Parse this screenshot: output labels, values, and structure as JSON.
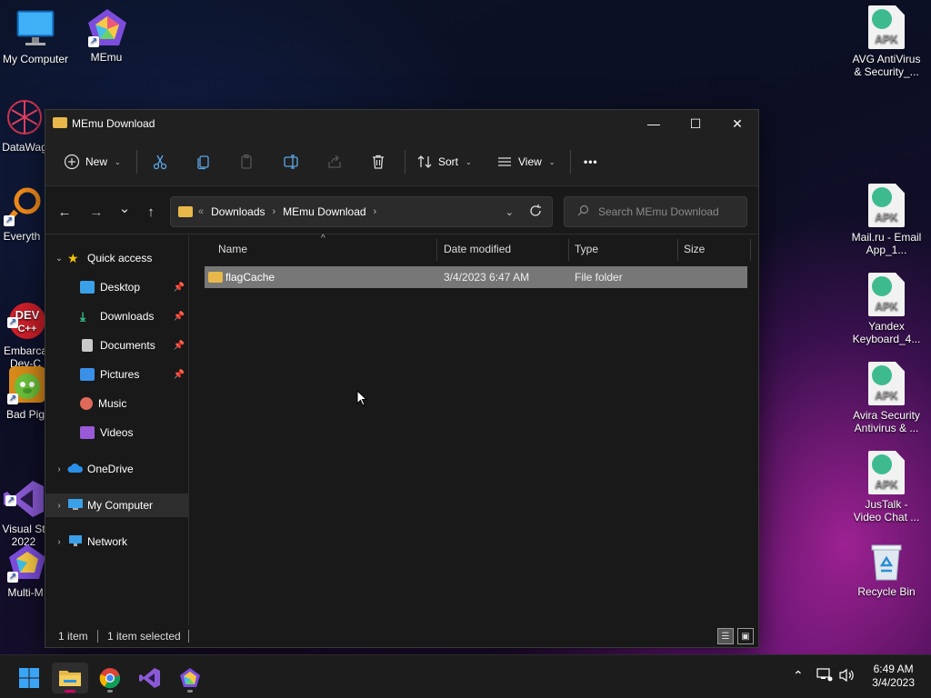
{
  "desktop": {
    "left_icons": [
      {
        "label": "My Computer"
      },
      {
        "label": "MEmu"
      },
      {
        "label": "DataWag"
      },
      {
        "label": "Everyth"
      },
      {
        "label": "Embarca\nDev-C"
      },
      {
        "label": "Bad Pig"
      },
      {
        "label": "Visual St\n2022"
      },
      {
        "label": "Multi-M"
      }
    ],
    "right_icons": [
      {
        "label": "AVG AntiVirus & Security_...",
        "badge": "APK"
      },
      {
        "label": "Mail.ru - Email App_1...",
        "badge": "APK"
      },
      {
        "label": "Yandex Keyboard_4...",
        "badge": "APK"
      },
      {
        "label": "Avira Security Antivirus & ...",
        "badge": "APK"
      },
      {
        "label": "JusTalk - Video Chat ...",
        "badge": "APK"
      },
      {
        "label": "Recycle Bin"
      }
    ]
  },
  "window": {
    "title": "MEmu Download",
    "controls": {
      "minimize": "—",
      "maximize": "☐",
      "close": "✕"
    }
  },
  "toolbar": {
    "new_label": "New",
    "sort_label": "Sort",
    "view_label": "View",
    "more_label": "•••"
  },
  "navigation": {
    "back": "←",
    "forward": "→",
    "recent": "⌄",
    "up": "↑",
    "breadcrumb_prefix": "«",
    "breadcrumb": [
      "Downloads",
      "MEmu Download"
    ],
    "search_placeholder": "Search MEmu Download"
  },
  "sidebar": {
    "quick_access": "Quick access",
    "items": [
      {
        "label": "Desktop",
        "pinned": true,
        "color": "#3aa0e8"
      },
      {
        "label": "Downloads",
        "pinned": true,
        "color": "#3ac18c"
      },
      {
        "label": "Documents",
        "pinned": true,
        "color": "#c8c8c8"
      },
      {
        "label": "Pictures",
        "pinned": true,
        "color": "#3a8fe8"
      },
      {
        "label": "Music",
        "pinned": false,
        "color": "#e06a5a"
      },
      {
        "label": "Videos",
        "pinned": false,
        "color": "#9a5ad8"
      }
    ],
    "onedrive": "OneDrive",
    "my_computer": "My Computer",
    "network": "Network"
  },
  "columns": {
    "name": "Name",
    "date_modified": "Date modified",
    "type": "Type",
    "size": "Size"
  },
  "files": [
    {
      "name": "flagCache",
      "date_modified": "3/4/2023 6:47 AM",
      "type": "File folder",
      "size": ""
    }
  ],
  "status": {
    "count": "1 item",
    "selected": "1 item selected"
  },
  "taskbar": {
    "time": "6:49 AM",
    "date": "3/4/2023"
  },
  "colors": {
    "folder": "#e8b84a",
    "selection": "#777777",
    "window_bg": "#191919",
    "accent_pink": "#cc0066"
  }
}
